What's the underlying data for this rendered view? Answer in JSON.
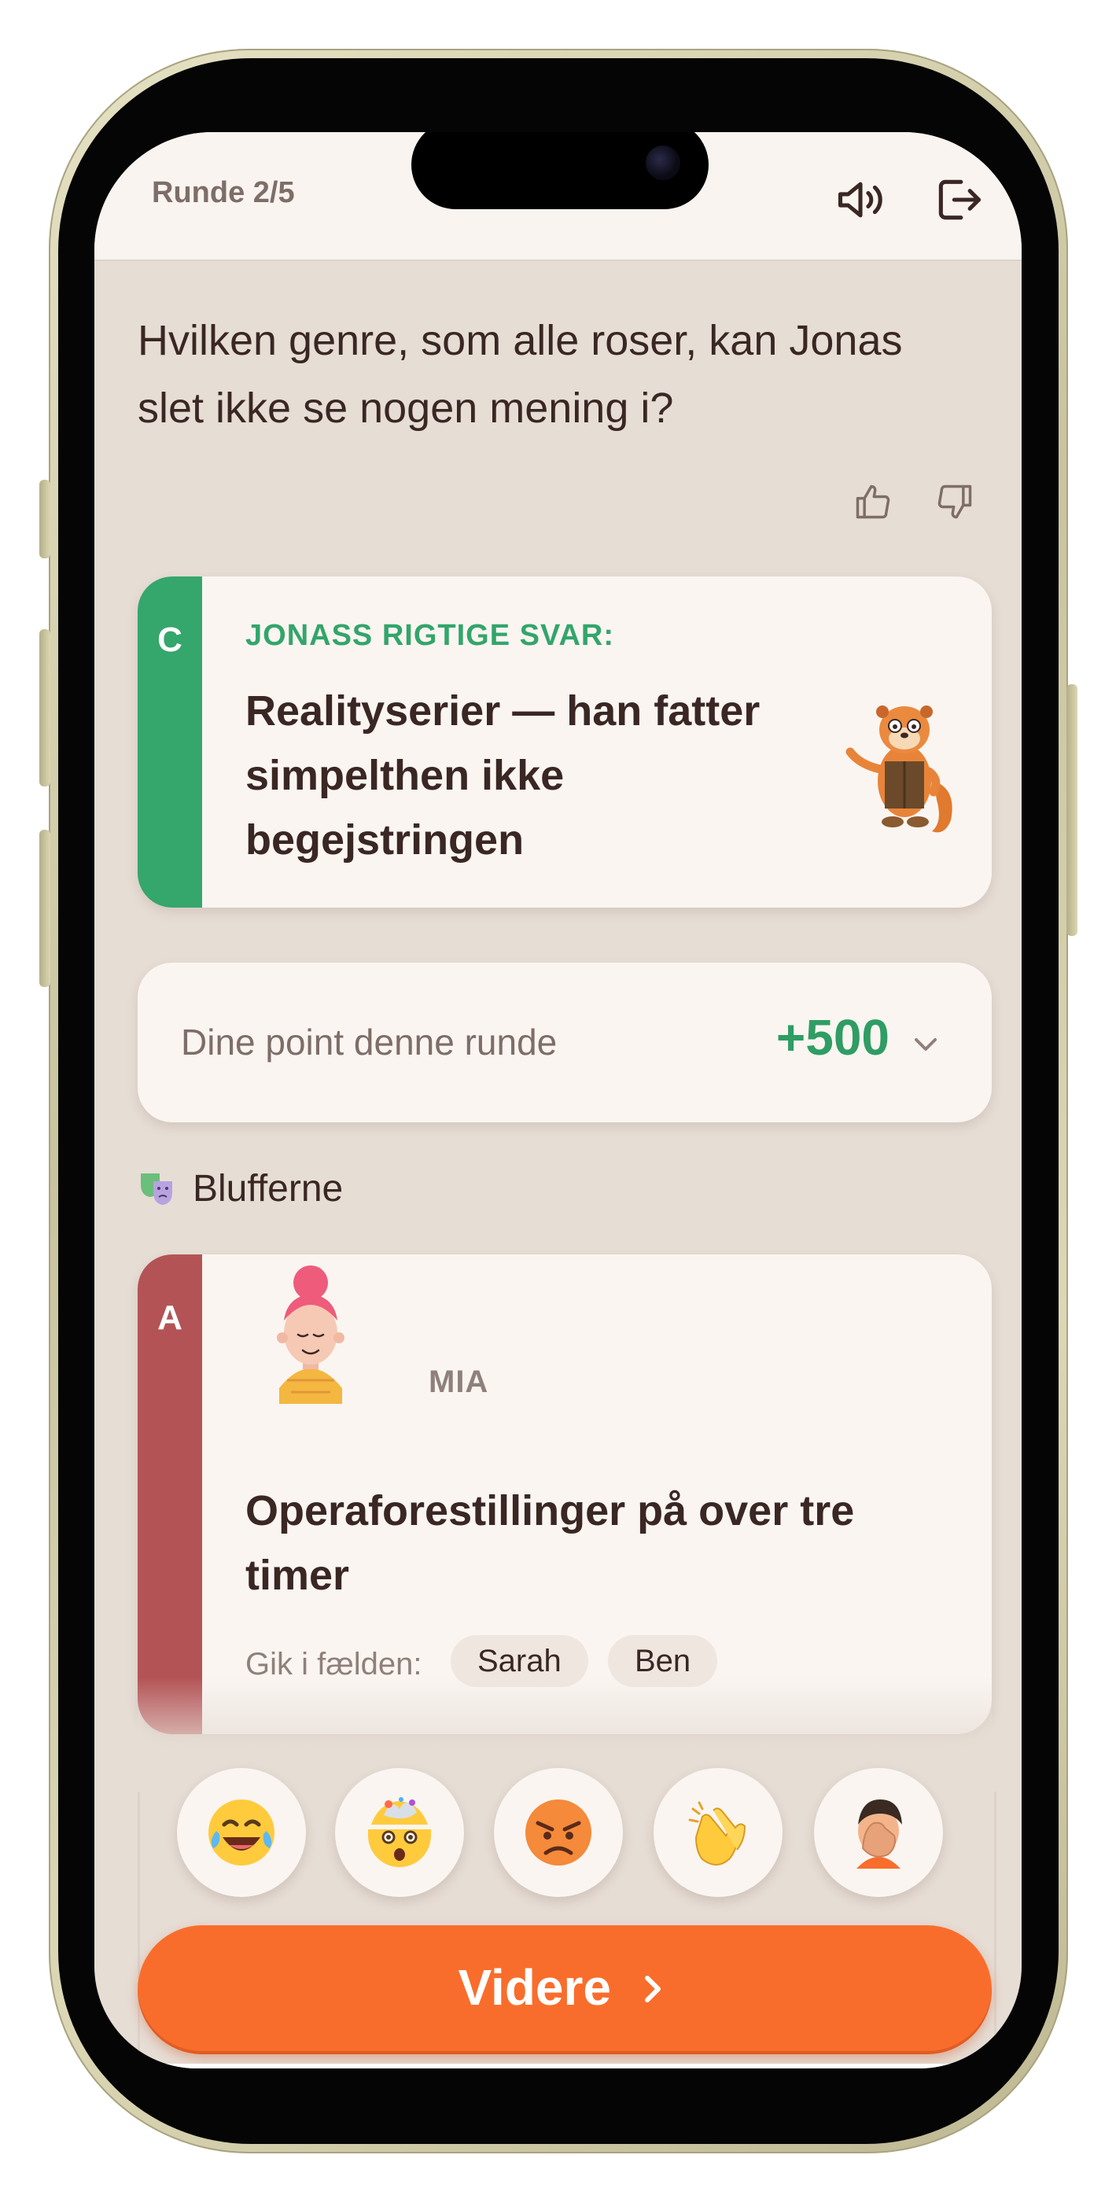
{
  "header": {
    "round_label": "Runde 2/5",
    "sound_icon": "speaker-icon",
    "exit_icon": "exit-icon"
  },
  "question": {
    "text": "Hvilken genre, som alle roser, kan Jonas slet ikke se nogen mening i?"
  },
  "correct_answer": {
    "letter": "C",
    "label": "JONASS RIGTIGE SVAR:",
    "text": "Realityserier — han fatter simpelthen ikke begejstringen",
    "mascot": "otter-mascot-icon",
    "color": "#35a66c"
  },
  "points": {
    "label": "Dine point denne runde",
    "value": "+500"
  },
  "bluffers": {
    "title": "Blufferne",
    "items": [
      {
        "letter": "A",
        "player": "MIA",
        "text": "Operaforestillinger på over tre timer",
        "fell_label": "Gik i fælden:",
        "fooled": [
          "Sarah",
          "Ben"
        ],
        "color": "#b45356"
      }
    ]
  },
  "reactions": [
    "laughing-tears-icon",
    "mind-blown-icon",
    "angry-face-icon",
    "clapping-hands-icon",
    "facepalm-icon"
  ],
  "continue_button": {
    "label": "Videre"
  }
}
